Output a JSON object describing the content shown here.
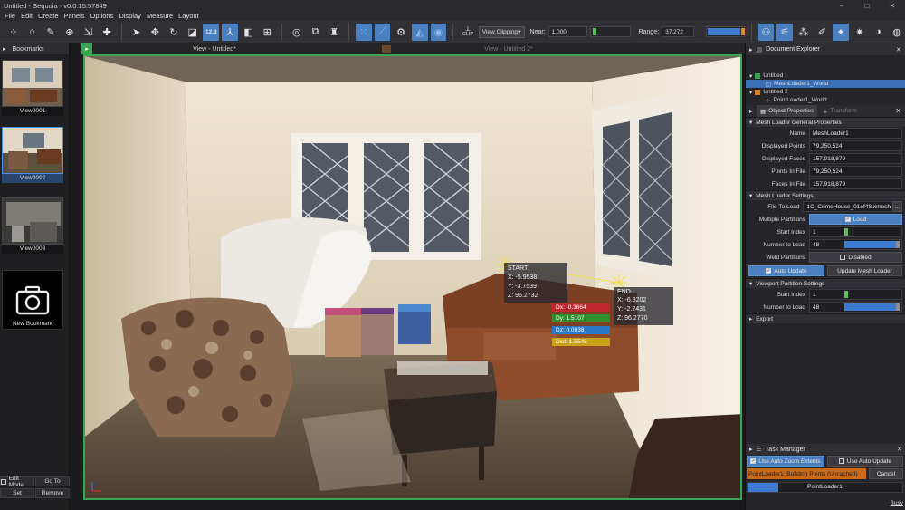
{
  "window": {
    "title": "Untitled - Sequoia - v0.0.15.57849",
    "minimize": "–",
    "maximize": "□",
    "close": "✕"
  },
  "menu": [
    "File",
    "Edit",
    "Create",
    "Panels",
    "Options",
    "Display",
    "Measure",
    "Layout"
  ],
  "toolbar": {
    "clip_label": "CLIP",
    "view_clipping": "View Clipping",
    "near_label": "Near:",
    "near_value": "1,000",
    "range_label": "Range:",
    "range_value": "37,272",
    "active_tool_label": "12.3"
  },
  "bookmarks": {
    "title": "Bookmarks",
    "items": [
      {
        "label": "View0001"
      },
      {
        "label": "View0002",
        "selected": true
      },
      {
        "label": "View0003"
      }
    ],
    "new_label": "New Bookmark",
    "edit_mode": "Edit Mode",
    "goto": "Go To",
    "set": "Set",
    "remove": "Remove"
  },
  "views": {
    "tab1": "View - Untitled*",
    "tab2": "View - Untitled 2*"
  },
  "measurement": {
    "start": {
      "title": "START",
      "x": "X:   -5.9538",
      "y": "Y:   -3.7539",
      "z": "Z:  96.2732"
    },
    "end": {
      "title": "END",
      "x": "X:   -6.3202",
      "y": "Y:   -2.2431",
      "z": "Z:  96.2770"
    },
    "deltas": [
      {
        "label": "Dx:  -0.3664",
        "color": "#c0282e"
      },
      {
        "label": "Dy:  1.5107",
        "color": "#2f8f2f"
      },
      {
        "label": "Dz:  0.0038",
        "color": "#2b78c2"
      },
      {
        "label": "Dist:  1.5545",
        "color": "#c9a21a"
      }
    ]
  },
  "explorer": {
    "title": "Document Explorer",
    "tree": [
      {
        "label": "Untitled",
        "color": "#2fa84f",
        "indent": 0
      },
      {
        "label": "MeshLoader1_World",
        "indent": 1,
        "selected": true
      },
      {
        "label": "Untitled 2",
        "color": "#e07a1a",
        "indent": 0
      },
      {
        "label": "PointLoader1_World",
        "indent": 1
      }
    ]
  },
  "properties": {
    "tab_object": "Object Properties",
    "tab_transform": "Transform",
    "general_title": "Mesh Loader General Properties",
    "general": [
      {
        "key": "Name",
        "value": "MeshLoader1"
      },
      {
        "key": "Displayed Points",
        "value": "79,250,524"
      },
      {
        "key": "Displayed Faces",
        "value": "157,918,879"
      },
      {
        "key": "Points In File",
        "value": "79,250,524"
      },
      {
        "key": "Faces In File",
        "value": "157,918,879"
      }
    ],
    "settings_title": "Mesh Loader Settings",
    "file_to_load_key": "File To Load",
    "file_to_load": "1C_CrimeHouse_01of48.xmesh",
    "browse": "...",
    "multi_key": "Multiple Partitions",
    "multi_value": "Load",
    "start_index_key": "Start Index",
    "start_index": "1",
    "start_index_fraction": 0.0,
    "number_to_load_key": "Number to Load",
    "number_to_load": "48",
    "number_to_load_fraction": 1.0,
    "weld_key": "Weld Partitions",
    "weld_value": "Disabled",
    "auto_update": "Auto Update",
    "update_loader": "Update Mesh Loader",
    "viewport_title": "Viewport Partition Settings",
    "vp_start_key": "Start Index",
    "vp_start": "1",
    "vp_start_fraction": 0.0,
    "vp_number_key": "Number to Load",
    "vp_number": "48",
    "vp_number_fraction": 1.0,
    "export_title": "Export"
  },
  "tasks": {
    "title": "Task Manager",
    "auto_zoom": "Use Auto Zoom Extents",
    "auto_update": "Use Auto Update",
    "task_label": "PointLoader1: Building Points (Uncached)",
    "cancel": "Cancel",
    "progress_label": "PointLoader1",
    "progress_fraction": 0.2,
    "status": "Busy"
  }
}
